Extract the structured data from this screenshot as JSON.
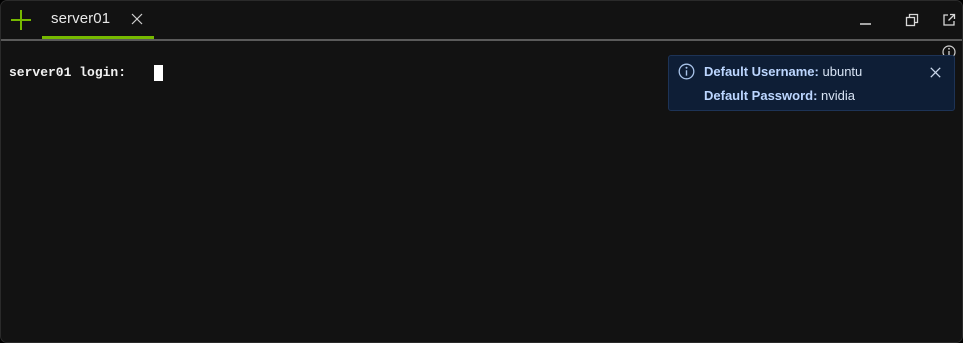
{
  "tabs": [
    {
      "label": "server01",
      "active": true
    }
  ],
  "terminal": {
    "prompt": "server01 login: "
  },
  "notification": {
    "username_label": "Default Username:",
    "username_value": "ubuntu",
    "password_label": "Default Password:",
    "password_value": "nvidia"
  },
  "colors": {
    "accent": "#76b900",
    "background": "#121212",
    "toast_bg": "#0e1e36"
  },
  "icons": {
    "add_tab": "plus-icon",
    "tab_close": "close-icon",
    "restore": "restore-window-icon",
    "popout": "external-link-icon",
    "info": "info-icon",
    "toast_close": "close-icon"
  }
}
